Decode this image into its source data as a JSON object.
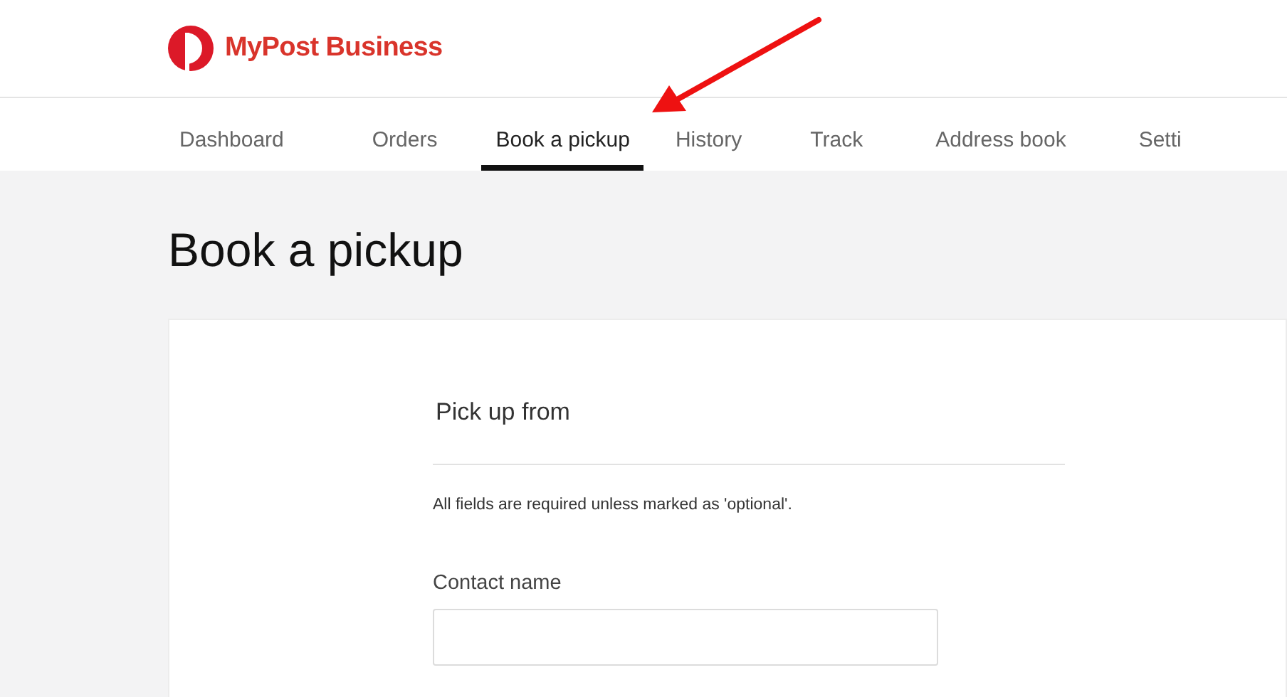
{
  "header": {
    "brand": "MyPost Business"
  },
  "tabs": [
    {
      "label": "Dashboard",
      "selected": false
    },
    {
      "label": "Orders",
      "selected": false
    },
    {
      "label": "Book a pickup",
      "selected": true
    },
    {
      "label": "History",
      "selected": false
    },
    {
      "label": "Track",
      "selected": false
    },
    {
      "label": "Address book",
      "selected": false
    },
    {
      "label": "Setti",
      "selected": false
    }
  ],
  "page_title": "Book a pickup",
  "form": {
    "section_title": "Pick up from",
    "note": "All fields are required unless marked as 'optional'.",
    "fields": [
      {
        "label": "Contact name"
      }
    ]
  },
  "annotation": {
    "kind": "arrow"
  }
}
